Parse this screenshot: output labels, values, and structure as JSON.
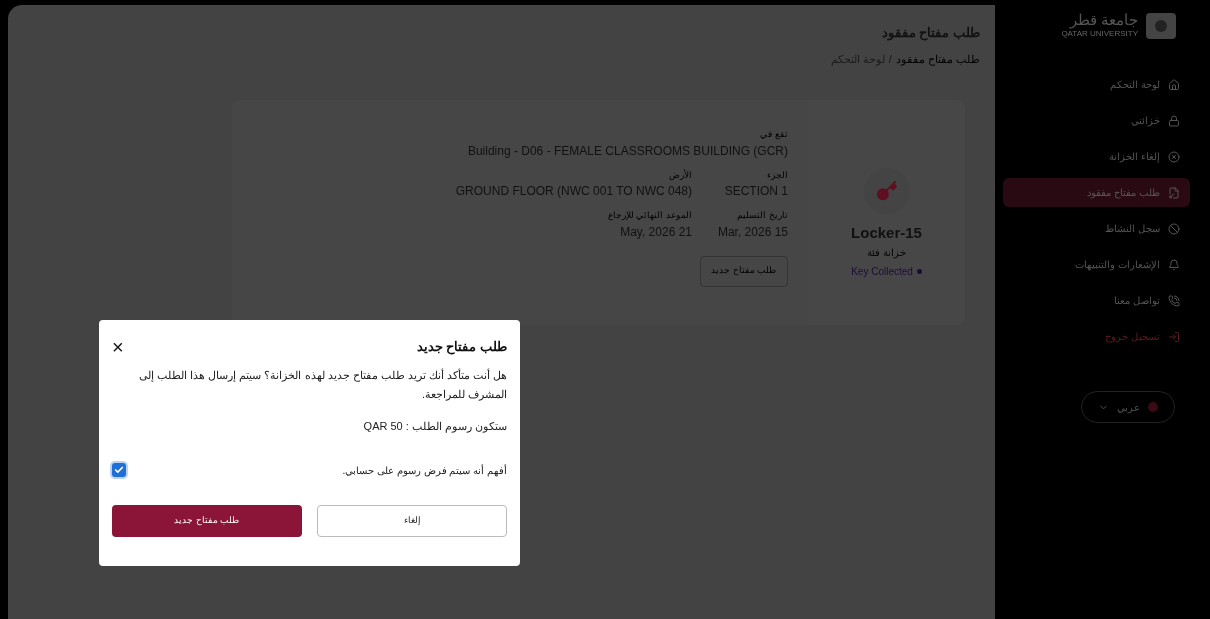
{
  "sidebar": {
    "logo": {
      "arabic": "جامعة قطر",
      "english": "QATAR UNIVERSITY"
    },
    "items": [
      {
        "label": "لوحة التحكم",
        "kind": "link",
        "selected": false
      },
      {
        "label": "خزائني",
        "kind": "link",
        "selected": false
      },
      {
        "label": "إلغاء الخزانة",
        "kind": "link",
        "selected": false
      },
      {
        "label": "طلب مفتاح مفقود",
        "kind": "link",
        "selected": true
      },
      {
        "label": "سجل النشاط",
        "kind": "link",
        "selected": false
      },
      {
        "label": "الإشعارات والتنبيهات",
        "kind": "link",
        "selected": false
      },
      {
        "label": "تواصل معنا",
        "kind": "link",
        "selected": false
      },
      {
        "label": "تسجيل خروج",
        "kind": "logout",
        "selected": false
      }
    ],
    "language": "عربي"
  },
  "page": {
    "title": "طلب مفتاح مفقود",
    "breadcrumb": [
      {
        "label": "طلب مفتاح مفقود",
        "current": true
      },
      {
        "label": "لوحة التحكم",
        "current": false
      }
    ],
    "separator": "/"
  },
  "locker": {
    "name": "Locker-15",
    "type": "خزانة فئة",
    "status": "Key Collected",
    "location_label": "تقع في",
    "location": "Building - D06 - FEMALE CLASSROOMS BUILDING (GCR)",
    "fields": [
      {
        "label": "الجزء",
        "value": "SECTION 1"
      },
      {
        "label": "الأرض",
        "value": "GROUND FLOOR (NWC 001 TO NWC 048)"
      },
      {
        "label": "تاريخ التسليم",
        "value": "Mar, 2026 15"
      },
      {
        "label": "الموعد النهائي للإرجاع",
        "value": "May, 2026 21"
      }
    ],
    "button": "طلب مفتاح جديد"
  },
  "dialog": {
    "title": "طلب مفتاح جديد",
    "close": "×",
    "message": "هل أنت متأكد أنك تريد طلب مفتاح جديد لهذه الخزانة؟ سيتم إرسال هذا الطلب إلى المشرف للمراجعة.",
    "fee": "ستكون رسوم الطلب : QAR 50",
    "agree": {
      "label": "أفهم أنه سيتم فرض رسوم على حسابي.",
      "checked": true
    },
    "cancel": "إلغاء",
    "confirm": "طلب مفتاح جديد"
  }
}
